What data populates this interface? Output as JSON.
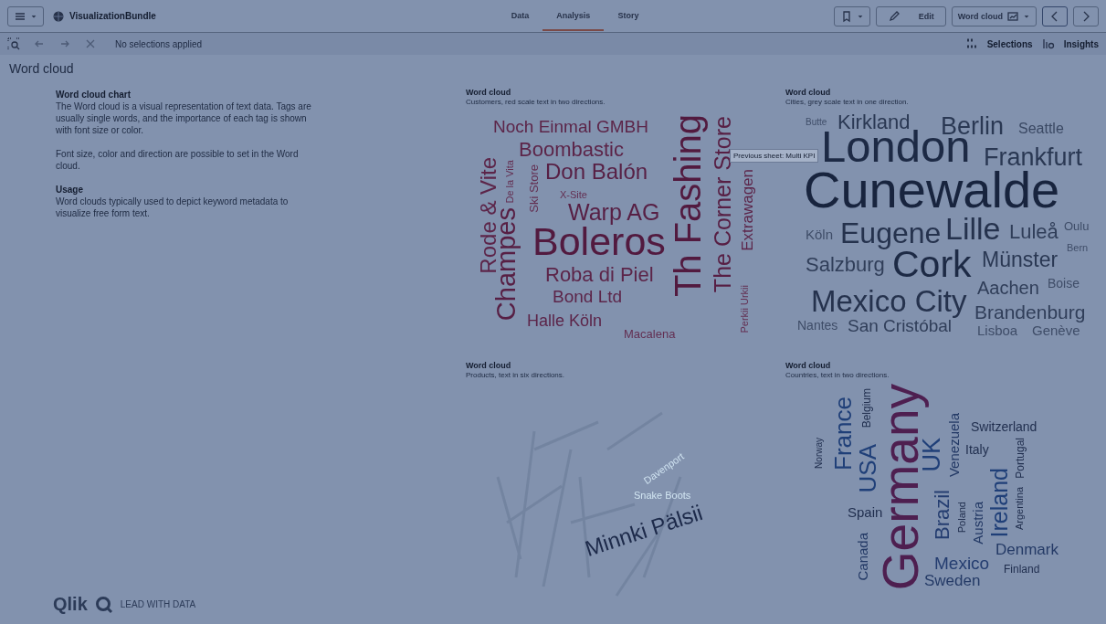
{
  "app_bar": {
    "app_name": "VisualizationBundle",
    "tabs": [
      {
        "label": "Data",
        "selected": false
      },
      {
        "label": "Analysis",
        "selected": true
      },
      {
        "label": "Story",
        "selected": false
      }
    ],
    "edit_label": "Edit",
    "sheet_name": "Word cloud"
  },
  "selection_bar": {
    "status": "No selections applied",
    "selections_label": "Selections",
    "insights_label": "Insights"
  },
  "sheet_title": "Word cloud",
  "description": {
    "heading": "Word cloud chart",
    "paragraphs": [
      "The Word cloud is a visual representation of text data. Tags are usually single words, and the importance of each tag is shown with font size or color.",
      "Font size, color and direction are possible to set in the Word cloud."
    ],
    "usage_heading": "Usage",
    "usage_text": "Word clouds typically used to depict keyword metadata to visualize free form text."
  },
  "charts": [
    {
      "title": "Word cloud",
      "subtitle": "Customers, red scale text in two directions.",
      "words": [
        {
          "text": "Noch Einmal GMBH",
          "kind": "horizontal",
          "color": "#5c2549"
        },
        {
          "text": "Boombastic",
          "kind": "horizontal",
          "color": "#5c2549"
        },
        {
          "text": "Don Balón",
          "kind": "horizontal",
          "color": "#571f44"
        },
        {
          "text": "X-Site",
          "kind": "horizontal",
          "color": "#632f52"
        },
        {
          "text": "Warp AG",
          "kind": "horizontal",
          "color": "#571f44"
        },
        {
          "text": "Boleros",
          "kind": "horizontal",
          "color": "#521a3f"
        },
        {
          "text": "Roba di Piel",
          "kind": "horizontal",
          "color": "#5c2549"
        },
        {
          "text": "Bond Ltd",
          "kind": "horizontal",
          "color": "#5c2549"
        },
        {
          "text": "Halle Köln",
          "kind": "horizontal",
          "color": "#5c2549"
        },
        {
          "text": "Macalena",
          "kind": "horizontal",
          "color": "#632f52"
        },
        {
          "text": "Rode & Vite",
          "kind": "vertical",
          "color": "#5c2549"
        },
        {
          "text": "Champes",
          "kind": "vertical",
          "color": "#571f44"
        },
        {
          "text": "De la Vita",
          "kind": "vertical",
          "color": "#632f52"
        },
        {
          "text": "Ski Store",
          "kind": "vertical",
          "color": "#632f52"
        },
        {
          "text": "Th Fashing",
          "kind": "vertical",
          "color": "#521a3f"
        },
        {
          "text": "The Corner Store",
          "kind": "vertical",
          "color": "#571f44"
        },
        {
          "text": "Extrawagen",
          "kind": "vertical",
          "color": "#5c2549"
        },
        {
          "text": "Perkii Urkii",
          "kind": "vertical",
          "color": "#632f52"
        }
      ]
    },
    {
      "title": "Word cloud",
      "subtitle": "Cities, grey scale text in one direction.",
      "words": [
        {
          "text": "Butte",
          "kind": "horizontal",
          "color": "#3f4d68"
        },
        {
          "text": "Kirkland",
          "kind": "horizontal",
          "color": "#2a3853"
        },
        {
          "text": "Berlin",
          "kind": "horizontal",
          "color": "#2a3853"
        },
        {
          "text": "Seattle",
          "kind": "horizontal",
          "color": "#3a4863"
        },
        {
          "text": "London",
          "kind": "horizontal",
          "color": "#1d2a45"
        },
        {
          "text": "Frankfurt",
          "kind": "horizontal",
          "color": "#2a3853"
        },
        {
          "text": "Cunewalde",
          "kind": "horizontal",
          "color": "#18243e"
        },
        {
          "text": "Köln",
          "kind": "horizontal",
          "color": "#3f4d68"
        },
        {
          "text": "Eugene",
          "kind": "horizontal",
          "color": "#25324d"
        },
        {
          "text": "Lille",
          "kind": "horizontal",
          "color": "#25324d"
        },
        {
          "text": "Luleå",
          "kind": "horizontal",
          "color": "#303e59"
        },
        {
          "text": "Oulu",
          "kind": "horizontal",
          "color": "#3f4d68"
        },
        {
          "text": "Bern",
          "kind": "horizontal",
          "color": "#3f4d68"
        },
        {
          "text": "Salzburg",
          "kind": "horizontal",
          "color": "#303e59"
        },
        {
          "text": "Cork",
          "kind": "horizontal",
          "color": "#1d2a45"
        },
        {
          "text": "Münster",
          "kind": "horizontal",
          "color": "#2a3853"
        },
        {
          "text": "Aachen",
          "kind": "horizontal",
          "color": "#303e59"
        },
        {
          "text": "Boise",
          "kind": "horizontal",
          "color": "#3f4d68"
        },
        {
          "text": "Mexico City",
          "kind": "horizontal",
          "color": "#25324d"
        },
        {
          "text": "Brandenburg",
          "kind": "horizontal",
          "color": "#303e59"
        },
        {
          "text": "Nantes",
          "kind": "horizontal",
          "color": "#3f4d68"
        },
        {
          "text": "San Cristóbal",
          "kind": "horizontal",
          "color": "#303e59"
        },
        {
          "text": "Lisboa",
          "kind": "horizontal",
          "color": "#3f4d68"
        },
        {
          "text": "Genève",
          "kind": "horizontal",
          "color": "#3f4d68"
        }
      ]
    },
    {
      "title": "Word cloud",
      "subtitle": "Products, text in six directions.",
      "words": [
        {
          "text": "Minnki Pälsii",
          "kind": "diagonal",
          "color": "#1d2a4a"
        },
        {
          "text": "Snake Boots",
          "kind": "horizontal",
          "color": "#d2e6f2"
        },
        {
          "text": "Davenport",
          "kind": "diagonal",
          "color": "#cfe2f0"
        }
      ]
    },
    {
      "title": "Word cloud",
      "subtitle": "Countries, text in two directions.",
      "words": [
        {
          "text": "Germany",
          "kind": "vertical",
          "color": "#4e1f50"
        },
        {
          "text": "France",
          "kind": "vertical",
          "color": "#1f3f78"
        },
        {
          "text": "USA",
          "kind": "vertical",
          "color": "#1f3f78"
        },
        {
          "text": "Norway",
          "kind": "vertical",
          "color": "#1f2d4d"
        },
        {
          "text": "Belgium",
          "kind": "vertical",
          "color": "#1f2d4d"
        },
        {
          "text": "UK",
          "kind": "vertical",
          "color": "#1f3f78"
        },
        {
          "text": "Venezuela",
          "kind": "vertical",
          "color": "#243a66"
        },
        {
          "text": "Switzerland",
          "kind": "horizontal",
          "color": "#1f2d4d"
        },
        {
          "text": "Italy",
          "kind": "horizontal",
          "color": "#1f2d4d"
        },
        {
          "text": "Portugal",
          "kind": "vertical",
          "color": "#1f2d4d"
        },
        {
          "text": "Ireland",
          "kind": "vertical",
          "color": "#1f3f78"
        },
        {
          "text": "Argentina",
          "kind": "vertical",
          "color": "#1f2d4d"
        },
        {
          "text": "Spain",
          "kind": "horizontal",
          "color": "#1f2d4d"
        },
        {
          "text": "Brazil",
          "kind": "vertical",
          "color": "#243d70"
        },
        {
          "text": "Poland",
          "kind": "vertical",
          "color": "#1f2d4d"
        },
        {
          "text": "Austria",
          "kind": "vertical",
          "color": "#243a66"
        },
        {
          "text": "Denmark",
          "kind": "horizontal",
          "color": "#243a66"
        },
        {
          "text": "Canada",
          "kind": "vertical",
          "color": "#243a66"
        },
        {
          "text": "Mexico",
          "kind": "horizontal",
          "color": "#243d70"
        },
        {
          "text": "Finland",
          "kind": "horizontal",
          "color": "#1f2d4d"
        },
        {
          "text": "Sweden",
          "kind": "horizontal",
          "color": "#243a66"
        }
      ]
    }
  ],
  "tooltip": "Previous sheet: Multi KPI",
  "branding": {
    "logo_text": "Qlik",
    "tagline": "LEAD WITH DATA"
  }
}
